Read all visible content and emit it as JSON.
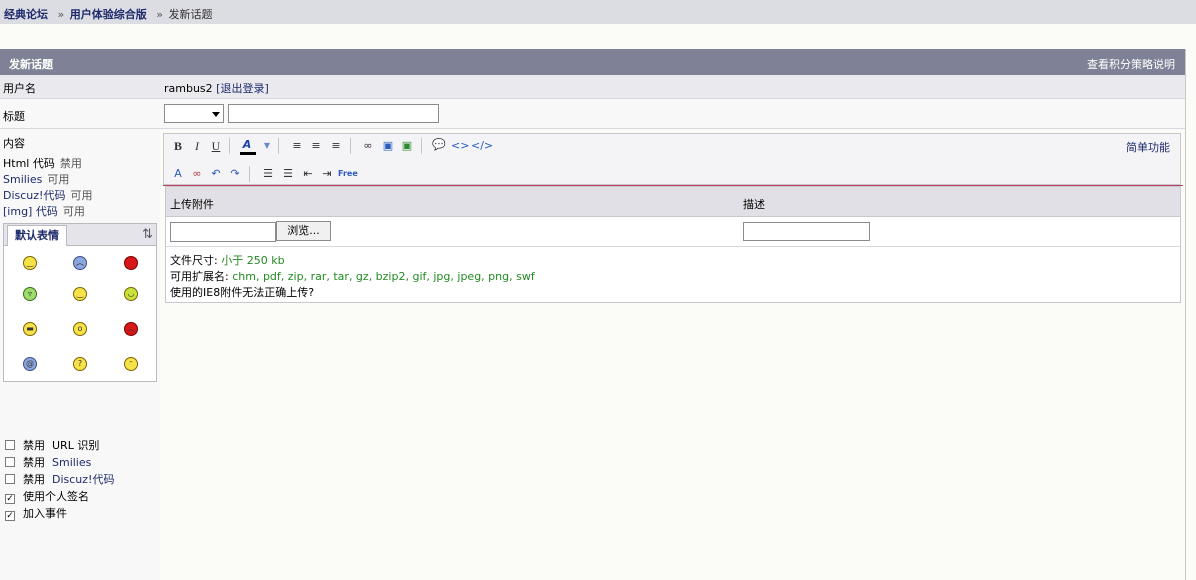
{
  "breadcrumb": {
    "forum": "经典论坛",
    "board": "用户体验综合版",
    "current": "发新话题",
    "separator": "»"
  },
  "header": {
    "title": "发新话题",
    "help_link": "查看积分策略说明"
  },
  "user_row": {
    "label": "用户名",
    "username": "rambus2",
    "logout": "[退出登录]"
  },
  "title_row": {
    "label": "标题",
    "type_select_value": "",
    "subject_value": ""
  },
  "content": {
    "label": "内容",
    "modes": [
      {
        "name": "Html 代码",
        "status": "禁用"
      },
      {
        "name": "Smilies",
        "status": "可用"
      },
      {
        "name": "Discuz!代码",
        "status": "可用"
      },
      {
        "name": "[img] 代码",
        "status": "可用"
      }
    ]
  },
  "smilies": {
    "tab_label": "默认表情",
    "tool_icon": "swap-icon",
    "items": [
      {
        "icon": "smile",
        "color": "#f7e24a"
      },
      {
        "icon": "sad",
        "color": "#8ea6e0"
      },
      {
        "icon": "angry",
        "color": "#d71818"
      },
      {
        "icon": "laugh",
        "color": "#9bdc6a"
      },
      {
        "icon": "grin",
        "color": "#f7e24a"
      },
      {
        "icon": "big-smile",
        "color": "#c8e23c"
      },
      {
        "icon": "cool",
        "color": "#f7e24a"
      },
      {
        "icon": "shock",
        "color": "#f7e24a"
      },
      {
        "icon": "mad",
        "color": "#d71818"
      },
      {
        "icon": "dizzy",
        "color": "#8ea6e0"
      },
      {
        "icon": "question",
        "color": "#f7e24a"
      },
      {
        "icon": "tongue",
        "color": "#f7e24a"
      }
    ]
  },
  "options": [
    {
      "prefix": "禁用",
      "name": "URL 识别",
      "checked": false,
      "highlight": false
    },
    {
      "prefix": "禁用",
      "name": "Smilies",
      "checked": false,
      "highlight": true
    },
    {
      "prefix": "禁用",
      "name": "Discuz!代码",
      "checked": false,
      "highlight": true
    },
    {
      "prefix": "",
      "name": "使用个人签名",
      "checked": true,
      "highlight": false
    },
    {
      "prefix": "",
      "name": "加入事件",
      "checked": true,
      "highlight": false
    }
  ],
  "editor": {
    "mode_switch": "简单功能",
    "toolbar_row1": [
      "bold-icon",
      "italic-icon",
      "underline-icon",
      "font-color-icon",
      "color-dropdown-icon",
      "align-left-icon",
      "align-center-icon",
      "align-right-icon",
      "link-icon",
      "image-icon",
      "media-icon",
      "quote-icon",
      "code-icon",
      "html-icon"
    ],
    "toolbar_row2": [
      "remove-format-icon",
      "unlink-icon",
      "undo-icon",
      "redo-icon",
      "ordered-list-icon",
      "unordered-list-icon",
      "outdent-icon",
      "indent-icon",
      "free-icon"
    ],
    "free_label": "Free"
  },
  "attachments": {
    "upload_header": "上传附件",
    "desc_header": "描述",
    "browse_label": "浏览...",
    "size_label": "文件尺寸:",
    "size_value": "小于  250 kb",
    "ext_label": "可用扩展名:",
    "ext_value": "chm, pdf, zip, rar, tar, gz, bzip2, gif, jpg, jpeg, png, swf",
    "ie8_note": "使用的IE8附件无法正确上传?"
  }
}
